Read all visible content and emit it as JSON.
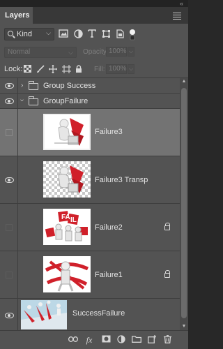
{
  "panel": {
    "collapse_glyph": "«",
    "tab_label": "Layers"
  },
  "filter": {
    "kind_label": "Kind",
    "icons": [
      "image-filter-icon",
      "adjustment-filter-icon",
      "type-filter-icon",
      "shape-filter-icon",
      "smart-object-filter-icon",
      "filter-toggle-icon"
    ]
  },
  "blend": {
    "mode": "Normal",
    "opacity_label": "Opacity:",
    "opacity_value": "100%",
    "fill_label": "Fill:",
    "fill_value": "100%"
  },
  "lock": {
    "label": "Lock:",
    "icons": [
      "lock-transparent-pixels-icon",
      "lock-image-pixels-icon",
      "lock-position-icon",
      "lock-artboard-icon",
      "lock-all-icon"
    ]
  },
  "layers": [
    {
      "name": "Group Success",
      "type": "group",
      "visible": true,
      "expanded": false
    },
    {
      "name": "GroupFailure",
      "type": "group",
      "visible": true,
      "expanded": true
    },
    {
      "name": "Failure3",
      "type": "layer",
      "visible": false,
      "selected": true,
      "locked": false
    },
    {
      "name": "Failure3 Transp",
      "type": "layer",
      "visible": true,
      "selected": false,
      "locked": false
    },
    {
      "name": "Failure2",
      "type": "layer",
      "visible": false,
      "selected": false,
      "locked": true
    },
    {
      "name": "Failure1",
      "type": "layer",
      "visible": false,
      "selected": false,
      "locked": true
    },
    {
      "name": "SuccessFailure",
      "type": "layer",
      "visible": true,
      "selected": false,
      "locked": false
    }
  ],
  "thumbnail_text": "FAIL",
  "footer_icons": [
    "link-layers-icon",
    "fx-icon",
    "add-mask-icon",
    "new-adjustment-icon",
    "new-group-icon",
    "new-layer-icon",
    "delete-layer-icon"
  ],
  "footer_fx_label": "fx",
  "colors": {
    "panel_bg": "#535353",
    "selected_row": "#737373",
    "accent_red": "#d0202a"
  }
}
